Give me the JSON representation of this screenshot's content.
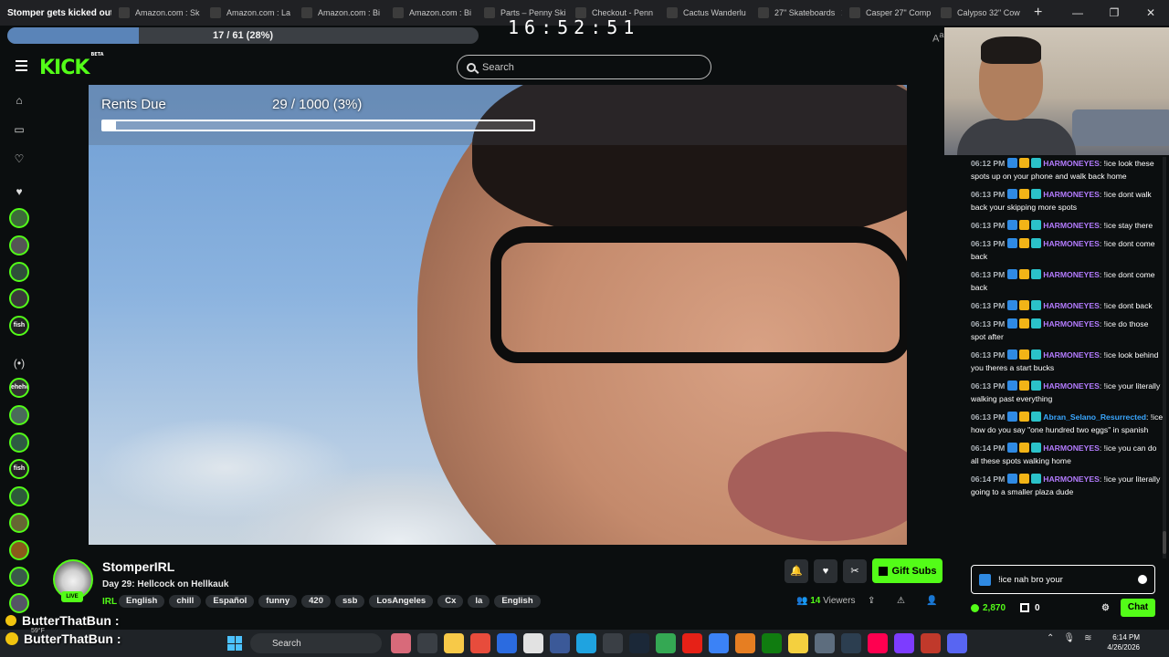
{
  "browser": {
    "tabs": [
      {
        "title": "Stomper gets kicked out",
        "active": true
      },
      {
        "title": "Amazon.com : Sk"
      },
      {
        "title": "Amazon.com : La"
      },
      {
        "title": "Amazon.com : Bi"
      },
      {
        "title": "Amazon.com : Bi"
      },
      {
        "title": "Parts – Penny Ski"
      },
      {
        "title": "Checkout - Penn"
      },
      {
        "title": "Cactus Wanderlu"
      },
      {
        "title": "27\" Skateboards"
      },
      {
        "title": "Casper 27\" Comp"
      },
      {
        "title": "Calypso 32\" Cow"
      }
    ],
    "new_tab": "+",
    "window_controls": [
      "—",
      "❐",
      "✕"
    ]
  },
  "overlay": {
    "progress_text": "17 / 61 (28%)",
    "progress_fraction": 0.28,
    "timer": "16:52:51"
  },
  "header": {
    "logo": "KICK",
    "logo_beta": "BETA",
    "search_placeholder": "Search"
  },
  "sidebar": {
    "avatars": [
      "",
      "",
      "",
      "",
      "fish",
      "(•)",
      "ehehee",
      "",
      "",
      "fish",
      "",
      "",
      "",
      "",
      ""
    ]
  },
  "stream_overlay": {
    "rents_label": "Rents Due",
    "rents_value": "29 / 1000 (3%)",
    "rents_fraction": 0.03
  },
  "chat": {
    "messages": [
      {
        "time": "06:12 PM",
        "user": "HARMONEYES",
        "color": "#b47cff",
        "text": "!ice look these spots up on your phone and walk back home"
      },
      {
        "time": "06:13 PM",
        "user": "HARMONEYES",
        "color": "#b47cff",
        "text": "!ice dont walk back your skipping more spots"
      },
      {
        "time": "06:13 PM",
        "user": "HARMONEYES",
        "color": "#b47cff",
        "text": "!ice stay there"
      },
      {
        "time": "06:13 PM",
        "user": "HARMONEYES",
        "color": "#b47cff",
        "text": "!ice dont come back"
      },
      {
        "time": "06:13 PM",
        "user": "HARMONEYES",
        "color": "#b47cff",
        "text": "!ice dont come back"
      },
      {
        "time": "06:13 PM",
        "user": "HARMONEYES",
        "color": "#b47cff",
        "text": "!ice dont back"
      },
      {
        "time": "06:13 PM",
        "user": "HARMONEYES",
        "color": "#b47cff",
        "text": "!ice do those spot after"
      },
      {
        "time": "06:13 PM",
        "user": "HARMONEYES",
        "color": "#b47cff",
        "text": "!ice look behind you theres a start bucks"
      },
      {
        "time": "06:13 PM",
        "user": "HARMONEYES",
        "color": "#b47cff",
        "text": "!ice your literally walking past everything"
      },
      {
        "time": "06:13 PM",
        "user": "Abran_Selano_Resurrected",
        "color": "#3aa7ff",
        "text": "!ice how do you say \"one hundred two eggs\" in spanish"
      },
      {
        "time": "06:14 PM",
        "user": "HARMONEYES",
        "color": "#b47cff",
        "text": "!ice you can do all these spots walking home"
      },
      {
        "time": "06:14 PM",
        "user": "HARMONEYES",
        "color": "#b47cff",
        "text": "!ice your literally going to a smaller plaza dude"
      }
    ],
    "input_value": "!ice nah bro your",
    "points": "2,870",
    "gifts": "0",
    "chat_button": "Chat"
  },
  "stream": {
    "streamer": "StomperIRL",
    "live": "LIVE",
    "title": "Day 29: Hellcock on Hellkauk",
    "category": "IRL",
    "tags": [
      "English",
      "chill",
      "Español",
      "funny",
      "420",
      "ssb",
      "LosAngeles",
      "Cx",
      "la",
      "English"
    ],
    "viewers_count": "14",
    "viewers_label": "Viewers",
    "gift_subs": "Gift Subs"
  },
  "ticker": {
    "text": "ButterThatBun :"
  },
  "taskbar": {
    "weather_temp": "59°F",
    "search_label": "Search",
    "time": "6:14 PM",
    "date": "4/26/2026"
  }
}
